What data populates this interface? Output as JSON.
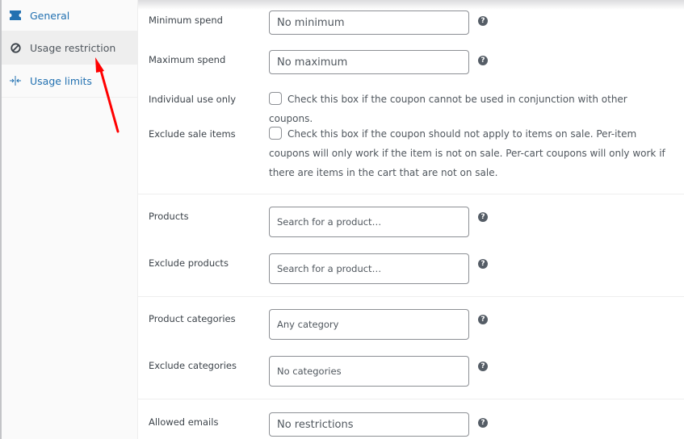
{
  "sidebar": {
    "tabs": [
      {
        "label": "General",
        "icon": "ticket-icon",
        "active": false
      },
      {
        "label": "Usage restriction",
        "icon": "block-icon",
        "active": true
      },
      {
        "label": "Usage limits",
        "icon": "limits-icon",
        "active": false
      }
    ]
  },
  "fields": {
    "minimum_spend": {
      "label": "Minimum spend",
      "placeholder": "No minimum"
    },
    "maximum_spend": {
      "label": "Maximum spend",
      "placeholder": "No maximum"
    },
    "individual_use": {
      "label": "Individual use only",
      "description": "Check this box if the coupon cannot be used in conjunction with other coupons.",
      "checked": false
    },
    "exclude_sale": {
      "label": "Exclude sale items",
      "description": "Check this box if the coupon should not apply to items on sale. Per-item coupons will only work if the item is not on sale. Per-cart coupons will only work if there are items in the cart that are not on sale.",
      "checked": false
    },
    "products": {
      "label": "Products",
      "placeholder": "Search for a product…"
    },
    "exclude_products": {
      "label": "Exclude products",
      "placeholder": "Search for a product…"
    },
    "product_categories": {
      "label": "Product categories",
      "placeholder": "Any category"
    },
    "exclude_categories": {
      "label": "Exclude categories",
      "placeholder": "No categories"
    },
    "allowed_emails": {
      "label": "Allowed emails",
      "placeholder": "No restrictions"
    }
  },
  "help_icon_glyph": "?",
  "colors": {
    "link": "#2271b1",
    "annotation_arrow": "#ff0000",
    "help_icon": "#555d66"
  }
}
